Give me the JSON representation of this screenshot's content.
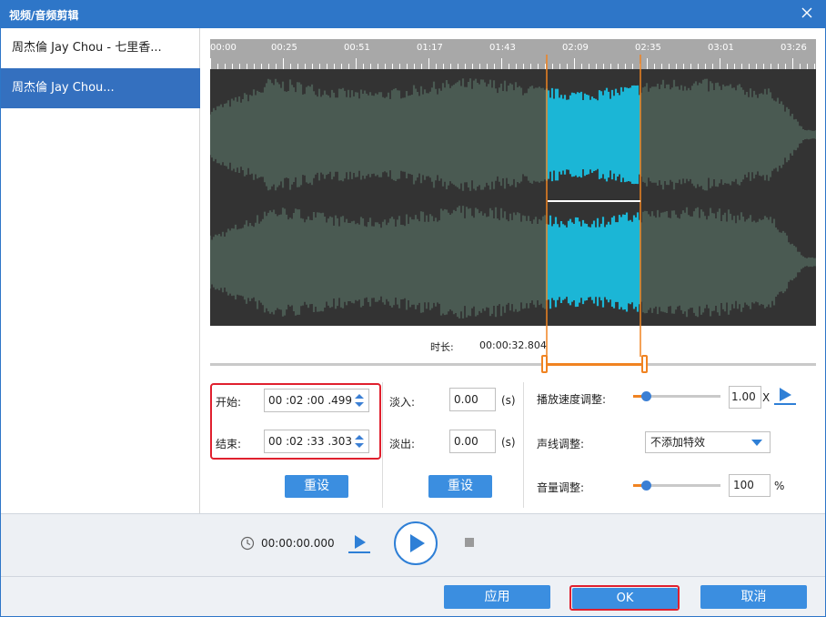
{
  "window": {
    "title": "视频/音频剪辑"
  },
  "sidebar": {
    "items": [
      {
        "label": "周杰倫 Jay Chou - 七里香..."
      },
      {
        "label": "周杰倫 Jay Chou..."
      }
    ]
  },
  "timeline": {
    "ticks": [
      "00:00",
      "00:25",
      "00:51",
      "01:17",
      "01:43",
      "02:09",
      "02:35",
      "03:01",
      "03:26"
    ]
  },
  "duration": {
    "label": "时长:",
    "value": "00:00:32.804"
  },
  "trim": {
    "start_label": "开始:",
    "start_value": "00 :02 :00 .499",
    "end_label": "结束:",
    "end_value": "00 :02 :33 .303",
    "reset_label": "重设"
  },
  "fade": {
    "in_label": "淡入:",
    "in_value": "0.00",
    "in_unit": "(s)",
    "out_label": "淡出:",
    "out_value": "0.00",
    "out_unit": "(s)",
    "reset_label": "重设"
  },
  "effects": {
    "speed_label": "播放速度调整:",
    "speed_value": "1.00",
    "speed_unit": "X",
    "voice_label": "声线调整:",
    "voice_value": "不添加特效",
    "volume_label": "音量调整:",
    "volume_value": "100",
    "volume_unit": "%"
  },
  "player": {
    "time": "00:00:00.000"
  },
  "footer": {
    "apply_label": "应用",
    "ok_label": "OK",
    "cancel_label": "取消"
  },
  "colors": {
    "accent": "#2e76c8",
    "orange": "#f08321",
    "selection_wave": "#1bb6d6",
    "wave": "#4a5a52",
    "highlight": "#e0202e"
  }
}
